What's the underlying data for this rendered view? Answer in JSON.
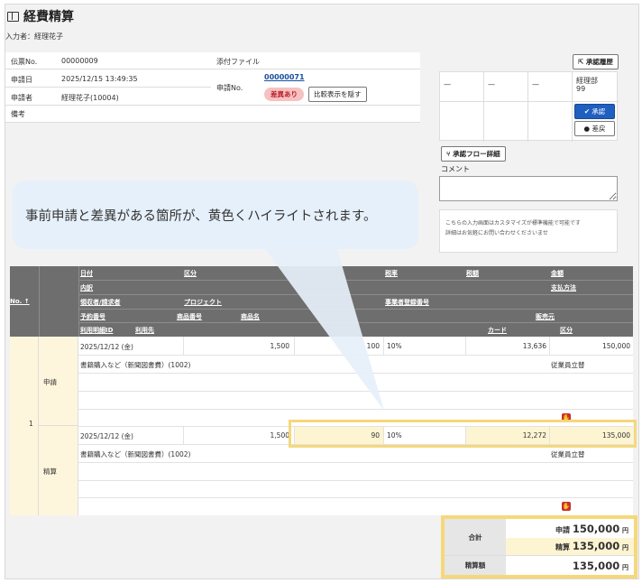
{
  "title": "経費精算",
  "creator": "入力者：経理花子",
  "info": {
    "slip_no_label": "伝票No.",
    "slip_no": "00000009",
    "attachment_label": "添付ファイル",
    "apply_date_label": "申請日",
    "apply_date": "2025/12/15 13:49:35",
    "apply_no_label": "申請No.",
    "apply_no": "00000071",
    "diff_badge": "差異あり",
    "hide_compare_button": "比較表示を隠す",
    "applicant_label": "申請者",
    "applicant": "経理花子(10004)",
    "remarks_label": "備考"
  },
  "approval": {
    "history_button": "承認履歴",
    "cells": [
      "—",
      "—",
      "—",
      "経理部",
      "99"
    ],
    "approve_button": "承認",
    "reject_button": "差戻",
    "flow_button": "承認フロー詳細",
    "comment_label": "コメント",
    "notice_line1": "こちらの入力画面はカスタマイズが標準機能で可能です",
    "notice_line2": "詳細はお気軽にお問い合わせくださいませ"
  },
  "callout": "事前申請と差異がある箇所が、黄色くハイライトされます。",
  "table": {
    "header": {
      "no": "No. ↑",
      "date": "日付",
      "category": "区分",
      "rate": "税率",
      "tax": "税額",
      "amount": "金額",
      "content": "内訳",
      "payment": "支払方法",
      "payee": "領収者/請求者",
      "project": "プロジェクト",
      "registration": "事業者登録番号",
      "reservation_no": "予約番号",
      "item_no": "商品番号",
      "item_name": "商品名",
      "supplier": "販売元",
      "usage_id": "利用明細ID",
      "usage": "利用先",
      "card": "カード",
      "division": "区分"
    },
    "row_no": "1",
    "apply": {
      "label": "申請",
      "date": "2025/12/12 (金)",
      "unit": "1,500",
      "qty": "100",
      "rate": "10%",
      "tax": "13,636",
      "amount": "150,000",
      "content": "書籍購入など（新聞図書費）(1002)",
      "payment": "従業員立替"
    },
    "settle": {
      "label": "精算",
      "date": "2025/12/12 (金)",
      "unit": "1,500",
      "qty": "90",
      "rate": "10%",
      "tax": "12,272",
      "amount": "135,000",
      "content": "書籍購入など（新聞図書費）(1002)",
      "payment": "従業員立替"
    }
  },
  "totals": {
    "sum_label": "合計",
    "apply_prefix": "申請",
    "apply_value": "150,000",
    "settle_prefix": "精算",
    "settle_value": "135,000",
    "yen": "円",
    "settle_total_label": "精算額",
    "settle_total_value": "135,000"
  }
}
